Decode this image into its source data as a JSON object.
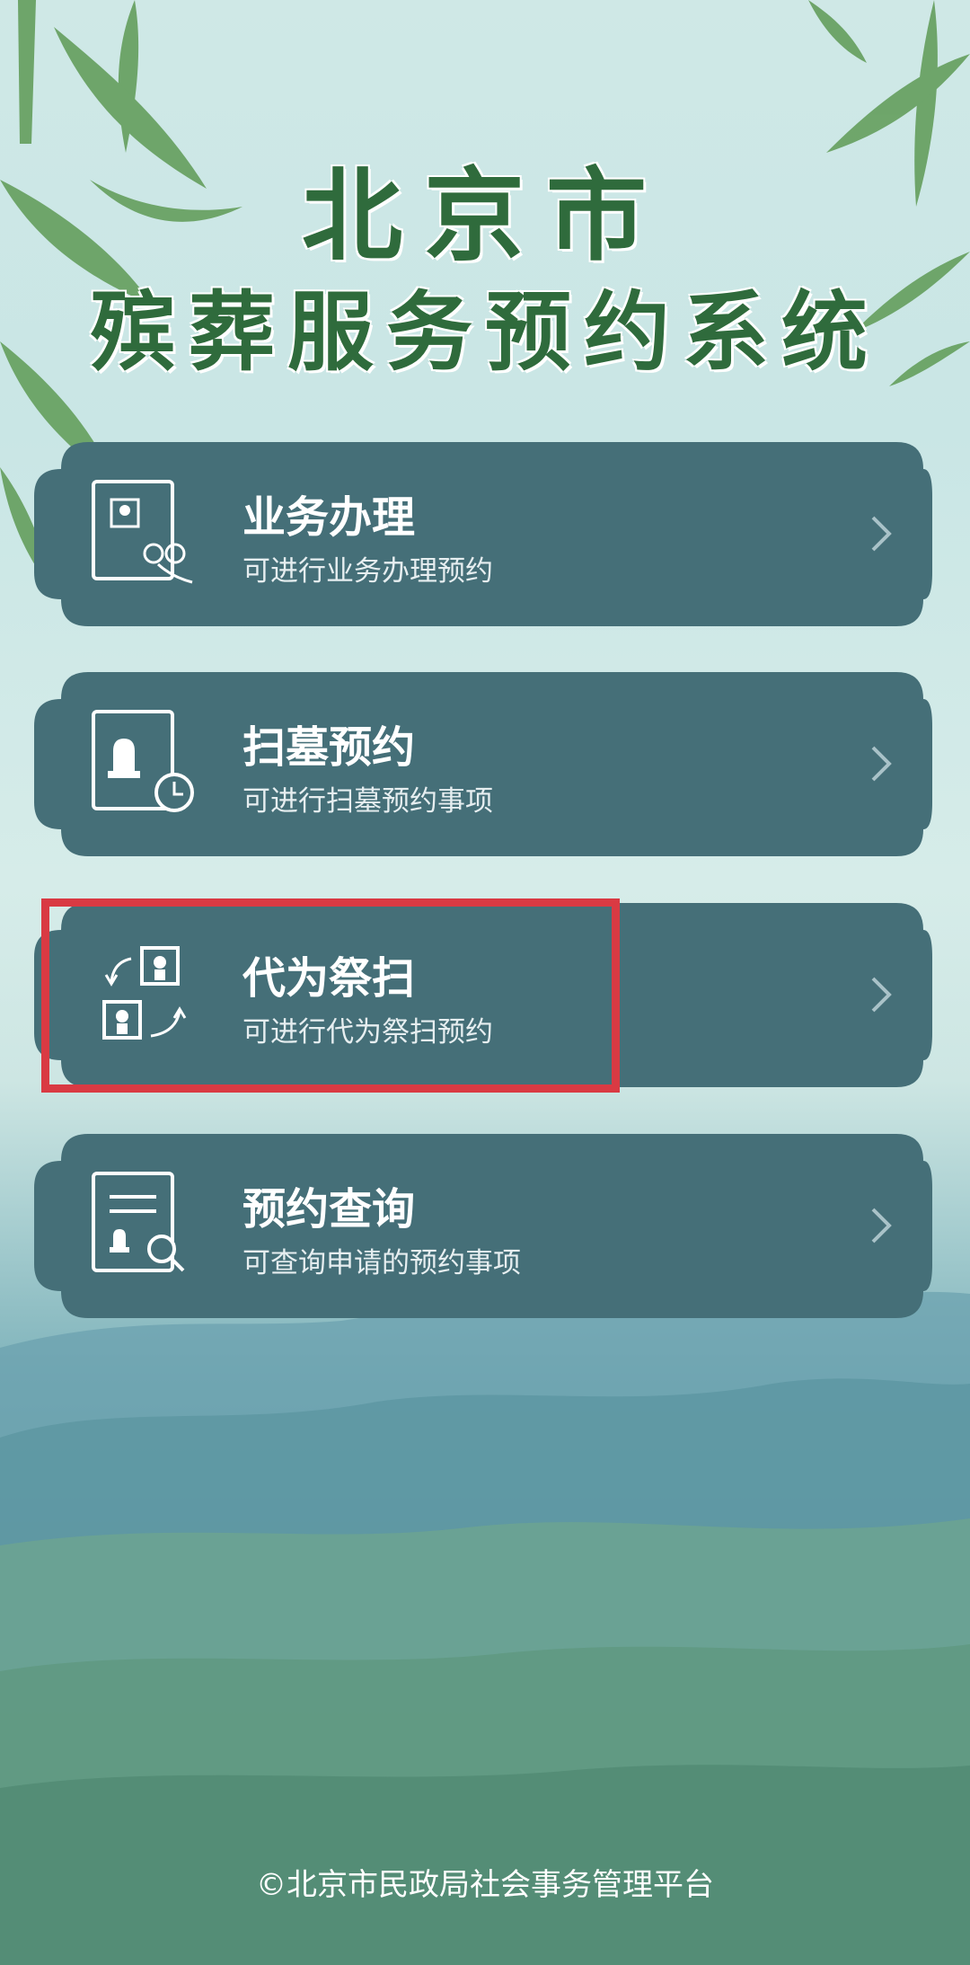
{
  "header": {
    "title_line1": "北京市",
    "title_line2": "殡葬服务预约系统"
  },
  "menu": [
    {
      "title": "业务办理",
      "subtitle": "可进行业务办理预约",
      "icon": "portrait-flower-icon"
    },
    {
      "title": "扫墓预约",
      "subtitle": "可进行扫墓预约事项",
      "icon": "tomb-clock-icon"
    },
    {
      "title": "代为祭扫",
      "subtitle": "可进行代为祭扫预约",
      "icon": "proxy-swap-icon"
    },
    {
      "title": "预约查询",
      "subtitle": "可查询申请的预约事项",
      "icon": "document-search-icon"
    }
  ],
  "footer": {
    "text": "©北京市民政局社会事务管理平台"
  },
  "colors": {
    "card": "#456f78",
    "title_green": "#2f6b3c",
    "highlight_red": "#d93a43"
  }
}
